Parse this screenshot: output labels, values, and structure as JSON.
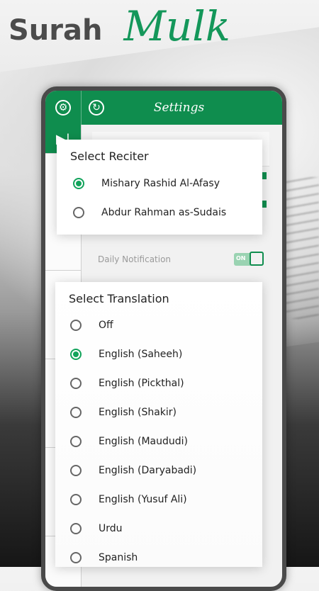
{
  "headline": {
    "word1": "Surah",
    "word2": "Mulk"
  },
  "appbar": {
    "title": "Settings",
    "settings_icon": "gear-icon",
    "refresh_icon": "refresh-icon"
  },
  "sidebar": {
    "play_icon": "play-skip-icon"
  },
  "notification": {
    "label": "Daily Notification",
    "toggle_text": "ON",
    "enabled": true
  },
  "reciter_dialog": {
    "title": "Select Reciter",
    "options": [
      {
        "label": "Mishary Rashid Al-Afasy",
        "selected": true
      },
      {
        "label": "Abdur Rahman as-Sudais",
        "selected": false
      }
    ]
  },
  "translation_dialog": {
    "title": "Select Translation",
    "options": [
      {
        "label": "Off",
        "selected": false
      },
      {
        "label": "English (Saheeh)",
        "selected": true
      },
      {
        "label": "English (Pickthal)",
        "selected": false
      },
      {
        "label": "English (Shakir)",
        "selected": false
      },
      {
        "label": "English (Maududi)",
        "selected": false
      },
      {
        "label": "English (Daryabadi)",
        "selected": false
      },
      {
        "label": "English (Yusuf Ali)",
        "selected": false
      },
      {
        "label": "Urdu",
        "selected": false
      },
      {
        "label": "Spanish",
        "selected": false
      }
    ]
  },
  "colors": {
    "brand_green": "#0f8d4e",
    "radio_green": "#12a35b",
    "headline_green": "#14975a"
  }
}
